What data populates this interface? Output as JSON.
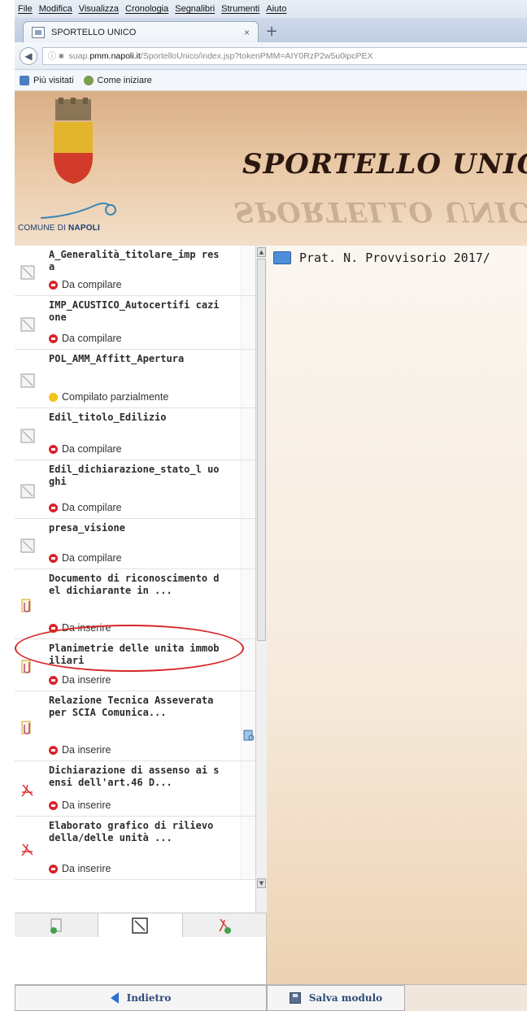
{
  "menubar": [
    "File",
    "Modifica",
    "Visualizza",
    "Cronologia",
    "Segnalibri",
    "Strumenti",
    "Aiuto"
  ],
  "tab": {
    "title": "SPORTELLO UNICO",
    "close": "×",
    "new": "+"
  },
  "url": {
    "prefix": "suap.",
    "domain": "pmm.napoli.it",
    "path": "/SportelloUnico/index.jsp?tokenPMM=AIY0RzP2w5u0ipcPEX"
  },
  "bookmarks": [
    "Più visitati",
    "Come iniziare"
  ],
  "header": {
    "logo_text_1": "COMUNE DI ",
    "logo_text_2": "NAPOLI",
    "title": "SPORTELLO UNICO"
  },
  "right": {
    "pratica": "Prat. N. Provvisorio 2017/"
  },
  "items": [
    {
      "name": "A_Generalità_titolare_imp resa",
      "status": "Da compilare",
      "color": "#d9232b"
    },
    {
      "name": "IMP_ACUSTICO_Autocertifi cazione",
      "status": "Da compilare",
      "color": "#d9232b"
    },
    {
      "name": "POL_AMM_Affitt_Apertura",
      "status": "Compilato parzialmente",
      "color": "#f2c318"
    },
    {
      "name": "Edil_titolo_Edilizio",
      "status": "Da compilare",
      "color": "#d9232b"
    },
    {
      "name": "Edil_dichiarazione_stato_l uoghi",
      "status": "Da compilare",
      "color": "#d9232b"
    },
    {
      "name": "presa_visione",
      "status": "Da compilare",
      "color": "#d9232b"
    },
    {
      "name": "Documento di riconoscimento del dichiarante in ...",
      "status": "Da inserire",
      "color": "#d9232b"
    },
    {
      "name": "Planimetrie delle unita immobiliari",
      "status": "Da inserire",
      "color": "#d9232b"
    },
    {
      "name": "Relazione Tecnica Asseverata per SCIA Comunica...",
      "status": "Da inserire",
      "color": "#d9232b"
    },
    {
      "name": "Dichiarazione di assenso ai sensi dell'art.46 D...",
      "status": "Da inserire",
      "color": "#d9232b"
    },
    {
      "name": "Elaborato grafico di rilievo della/delle unità ...",
      "status": "Da inserire",
      "color": "#d9232b"
    }
  ],
  "buttons": {
    "back": "Indietro",
    "save": "Salva modulo"
  }
}
